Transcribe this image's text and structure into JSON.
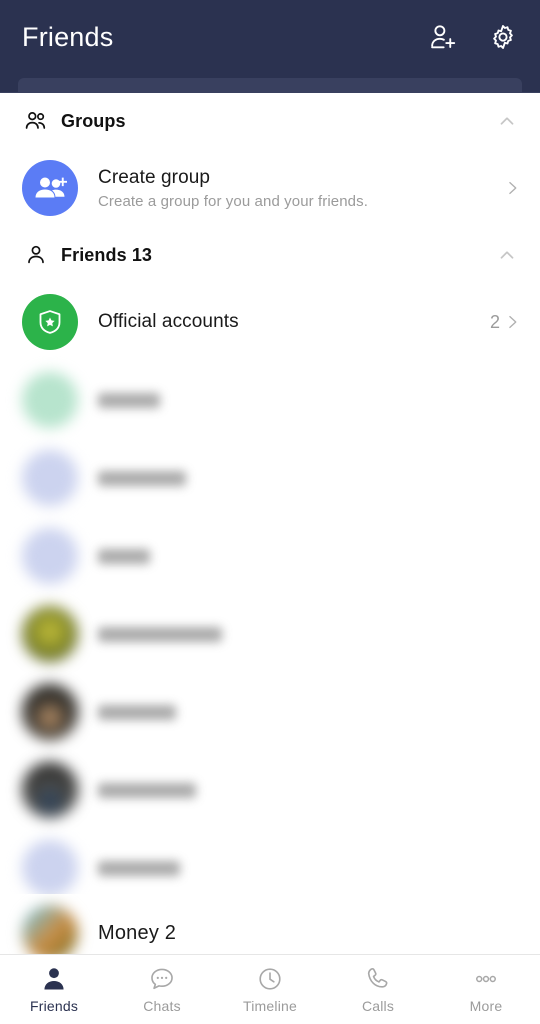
{
  "header": {
    "title": "Friends",
    "add_friend_icon": "person-add-icon",
    "settings_icon": "gear-icon",
    "search_placeholder": "",
    "background_color": "#2b3250"
  },
  "sections": [
    {
      "id": "groups",
      "label": "Groups",
      "icon": "two-people-icon",
      "collapse_icon": "chevron-up-icon",
      "rows": [
        {
          "id": "create-group",
          "title": "Create group",
          "subtitle": "Create a group for you and your friends.",
          "avatar_icon": "group-add-icon",
          "avatar_color": "#5b7cf5",
          "accessory": "chevron-right-icon",
          "count": ""
        }
      ]
    },
    {
      "id": "friends",
      "label": "Friends 13",
      "icon": "person-icon",
      "collapse_icon": "chevron-up-icon",
      "rows": [
        {
          "id": "official-accounts",
          "title": "Official accounts",
          "subtitle": "",
          "avatar_icon": "shield-star-icon",
          "avatar_color": "#2cb34a",
          "accessory": "chevron-right-icon",
          "count": "2"
        }
      ]
    }
  ],
  "friend_list": [
    {
      "id": "friend-1",
      "name": "",
      "avatar_style": "mint",
      "avatar_type": "placeholder",
      "name_width": 62,
      "redacted": true
    },
    {
      "id": "friend-2",
      "name": "",
      "avatar_style": "lav",
      "avatar_type": "placeholder",
      "name_width": 88,
      "redacted": true
    },
    {
      "id": "friend-3",
      "name": "",
      "avatar_style": "lav",
      "avatar_type": "placeholder",
      "name_width": 52,
      "redacted": true
    },
    {
      "id": "friend-4",
      "name": "",
      "avatar_style": "olive",
      "avatar_type": "photo",
      "name_width": 124,
      "redacted": true
    },
    {
      "id": "friend-5",
      "name": "",
      "avatar_style": "dark",
      "avatar_type": "photo",
      "name_width": 78,
      "redacted": true
    },
    {
      "id": "friend-6",
      "name": "",
      "avatar_style": "dark2",
      "avatar_type": "photo",
      "name_width": 98,
      "redacted": true
    },
    {
      "id": "friend-7",
      "name": "",
      "avatar_style": "lav",
      "avatar_type": "placeholder",
      "name_width": 82,
      "redacted": true
    }
  ],
  "last_row": {
    "id": "friend-8",
    "name": "Money 2",
    "avatar_style": "photo",
    "redacted": false
  },
  "tabbar": {
    "items": [
      {
        "id": "friends",
        "label": "Friends",
        "icon": "person-filled-icon",
        "active": true
      },
      {
        "id": "chats",
        "label": "Chats",
        "icon": "chat-bubble-icon",
        "active": false
      },
      {
        "id": "timeline",
        "label": "Timeline",
        "icon": "clock-icon",
        "active": false
      },
      {
        "id": "calls",
        "label": "Calls",
        "icon": "phone-icon",
        "active": false
      },
      {
        "id": "more",
        "label": "More",
        "icon": "more-dots-icon",
        "active": false
      }
    ],
    "active_color": "#2b3250",
    "inactive_color": "#9b9b9b"
  }
}
